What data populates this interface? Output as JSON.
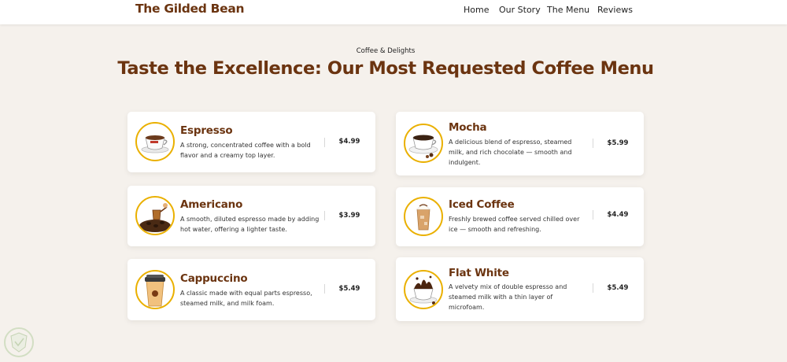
{
  "header": {
    "brand": "The Gilded Bean",
    "nav": [
      "Home",
      "Our Story",
      "The Menu",
      "Reviews"
    ]
  },
  "section": {
    "eyebrow": "Coffee & Delights",
    "title": "Taste the Excellence: Our Most Requested Coffee Menu"
  },
  "menu": [
    {
      "name": "Espresso",
      "desc": "A strong, concentrated coffee with a bold flavor and a creamy top layer.",
      "price": "$4.99",
      "icon": "espresso-cup-icon"
    },
    {
      "name": "Mocha",
      "desc": "A delicious blend of espresso, steamed milk, and rich chocolate — smooth and indulgent.",
      "price": "$5.99",
      "icon": "mocha-cup-icon"
    },
    {
      "name": "Americano",
      "desc": "A smooth, diluted espresso made by adding hot water, offering a lighter taste.",
      "price": "$3.99",
      "icon": "coffee-beans-icon"
    },
    {
      "name": "Iced Coffee",
      "desc": "Freshly brewed coffee served chilled over ice — smooth and refreshing.",
      "price": "$4.49",
      "icon": "iced-coffee-glass-icon"
    },
    {
      "name": "Cappuccino",
      "desc": "A classic made with equal parts espresso, steamed milk, and milk foam.",
      "price": "$5.49",
      "icon": "takeaway-cup-icon"
    },
    {
      "name": "Flat White",
      "desc": "A velvety mix of double espresso and steamed milk with a thin layer of microfoam.",
      "price": "$5.49",
      "icon": "splash-cup-icon"
    }
  ],
  "colors": {
    "brand": "#6b3410",
    "background": "#f5f1ec",
    "card": "#ffffff",
    "thumb_border": "#eab000"
  }
}
